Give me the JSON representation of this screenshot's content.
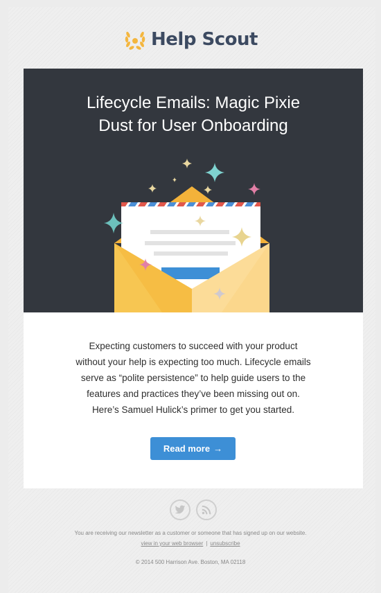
{
  "brand": {
    "name": "Help Scout",
    "accent": "#3c4a61",
    "laurel_color": "#f4b63e"
  },
  "hero": {
    "title_line1": "Lifecycle Emails: Magic Pixie",
    "title_line2": "Dust for User Onboarding",
    "background": "#33373e",
    "illustration": "open-envelope-with-sparkles"
  },
  "content": {
    "lines": [
      "Expecting customers to succeed with your product",
      "without your help is expecting too much. Lifecycle emails",
      "serve as “polite persistence” to help guide users to the",
      "features and practices they’ve been missing out on.",
      "Here’s Samuel Hulick’s primer to get you started."
    ],
    "cta_label": "Read more",
    "cta_arrow": "→",
    "cta_color": "#3d8fd6"
  },
  "footer": {
    "social": [
      {
        "name": "twitter-icon"
      },
      {
        "name": "rss-icon"
      }
    ],
    "notice": "You are receiving our newsletter as a customer or someone that has signed up on our website.",
    "view_in_browser": "view in your web browser",
    "separator": "|",
    "unsubscribe": "unsubscribe",
    "address": "© 2014 500 Harrison Ave. Boston, MA 02118"
  }
}
